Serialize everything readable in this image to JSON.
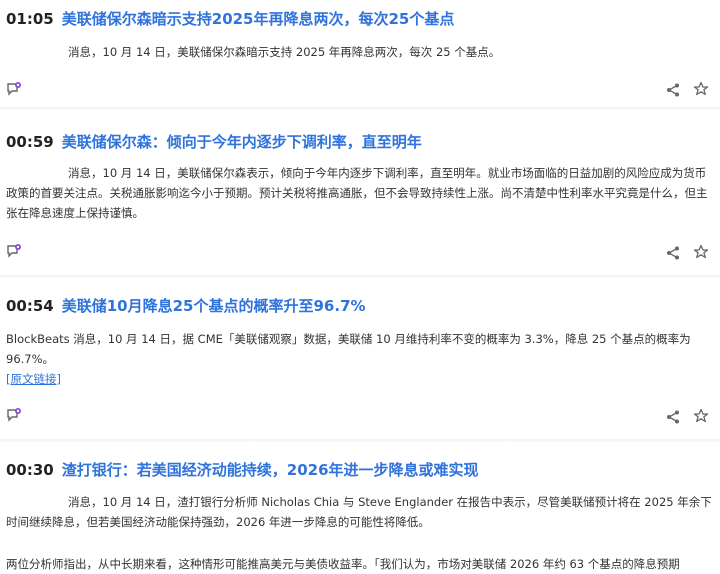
{
  "news": [
    {
      "time": "01:05",
      "title": "美联储保尔森暗示支持2025年再降息两次，每次25个基点",
      "body": "消息，10 月 14 日，美联储保尔森暗示支持 2025 年再降息两次，每次 25 个基点。"
    },
    {
      "time": "00:59",
      "title": "美联储保尔森：倾向于今年内逐步下调利率，直至明年",
      "body": "消息，10 月 14 日，美联储保尔森表示，倾向于今年内逐步下调利率，直至明年。就业市场面临的日益加剧的风险应成为货币政策的首要关注点。关税通胀影响迄今小于预期。预计关税将推高通胀，但不会导致持续性上涨。尚不清楚中性利率水平究竟是什么，但主张在降息速度上保持谨慎。"
    },
    {
      "time": "00:54",
      "title": "美联储10月降息25个基点的概率升至96.7%",
      "body": "BlockBeats 消息，10 月 14 日，据 CME「美联储观察」数据，美联储 10 月维持利率不变的概率为 3.3%，降息 25 个基点的概率为 96.7%。",
      "link": "[原文链接]"
    },
    {
      "time": "00:30",
      "title": "渣打银行：若美国经济动能持续，2026年进一步降息或难实现",
      "body": "消息，10 月 14 日，渣打银行分析师 Nicholas Chia 与 Steve Englander 在报告中表示，尽管美联储预计将在 2025 年余下时间继续降息，但若美国经济动能保持强劲，2026 年进一步降息的可能性将降低。",
      "body2": "两位分析师指出，从中长期来看，这种情形可能推高美元与美债收益率。「我们认为，市场对美联储 2026 年约 63 个基点的降息预期"
    }
  ],
  "icons": {
    "comment": "comment-icon",
    "share": "share-icon",
    "favorite": "star-icon"
  },
  "colors": {
    "title": "#2f73dd",
    "icon_accent": "#8a4fd8",
    "icon_gray": "#666666"
  }
}
